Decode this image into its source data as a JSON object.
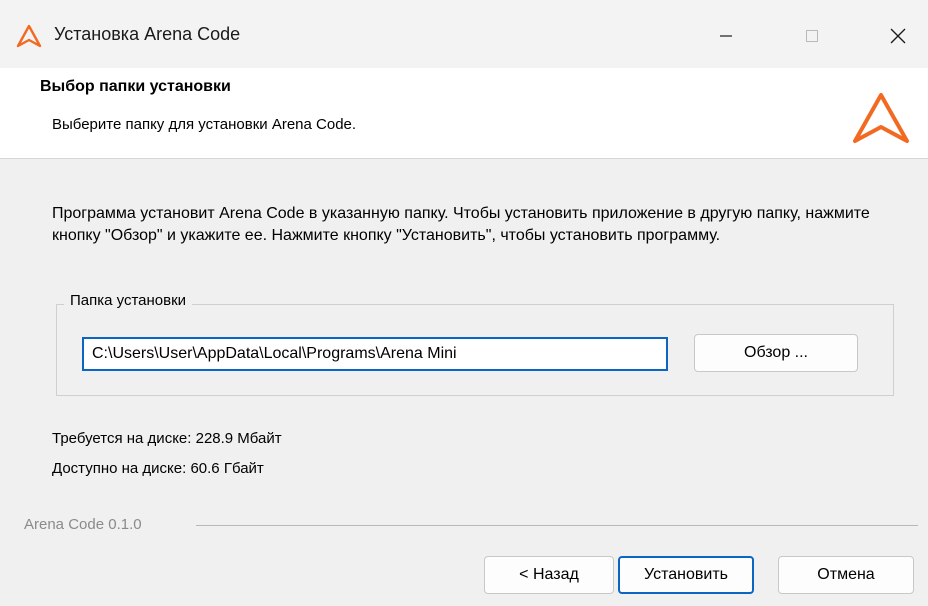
{
  "window": {
    "title": "Установка Arena Code",
    "controls": [
      "minimize-icon",
      "maximize-icon",
      "close-icon"
    ]
  },
  "header": {
    "title": "Выбор папки установки",
    "subtitle": "Выберите папку для установки Arena Code.",
    "logo": "arena-triangle-logo"
  },
  "body": {
    "description": "Программа установит Arena Code в указанную папку. Чтобы установить приложение в другую папку, нажмите кнопку \"Обзор\" и укажите ее. Нажмите кнопку \"Установить\", чтобы установить программу.",
    "group_label": "Папка установки",
    "install_path": "C:\\Users\\User\\AppData\\Local\\Programs\\Arena Mini",
    "browse_label": "Обзор ...",
    "space_required": "Требуется на диске: 228.9 Мбайт",
    "space_available": "Доступно на диске: 60.6 Гбайт"
  },
  "footer": {
    "version": "Arena Code 0.1.0",
    "back_label": "< Назад",
    "install_label": "Установить",
    "cancel_label": "Отмена"
  },
  "colors": {
    "accent": "#f26a21",
    "focus": "#0a66c2"
  }
}
